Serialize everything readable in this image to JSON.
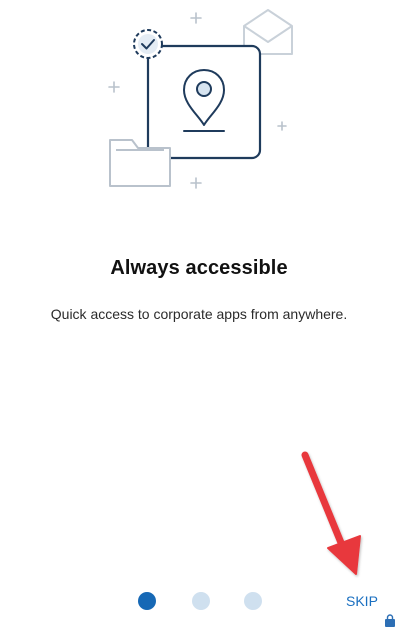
{
  "onboarding": {
    "headline": "Always accessible",
    "description": "Quick access to corporate apps from anywhere.",
    "skip_label": "SKIP"
  },
  "pager": {
    "total_pages": 3,
    "current_page": 1
  },
  "colors": {
    "accent": "#1a6fc0",
    "illustration_stroke": "#1f3b5c",
    "dot_active": "#1668b5",
    "dot_inactive": "#cfe0ef",
    "annotation_arrow": "#e8383d"
  },
  "icons": {
    "illustration": "location-pin-card-icon",
    "check": "check-badge-icon",
    "mail": "envelope-icon",
    "folder": "folder-icon",
    "lock": "lock-icon"
  }
}
